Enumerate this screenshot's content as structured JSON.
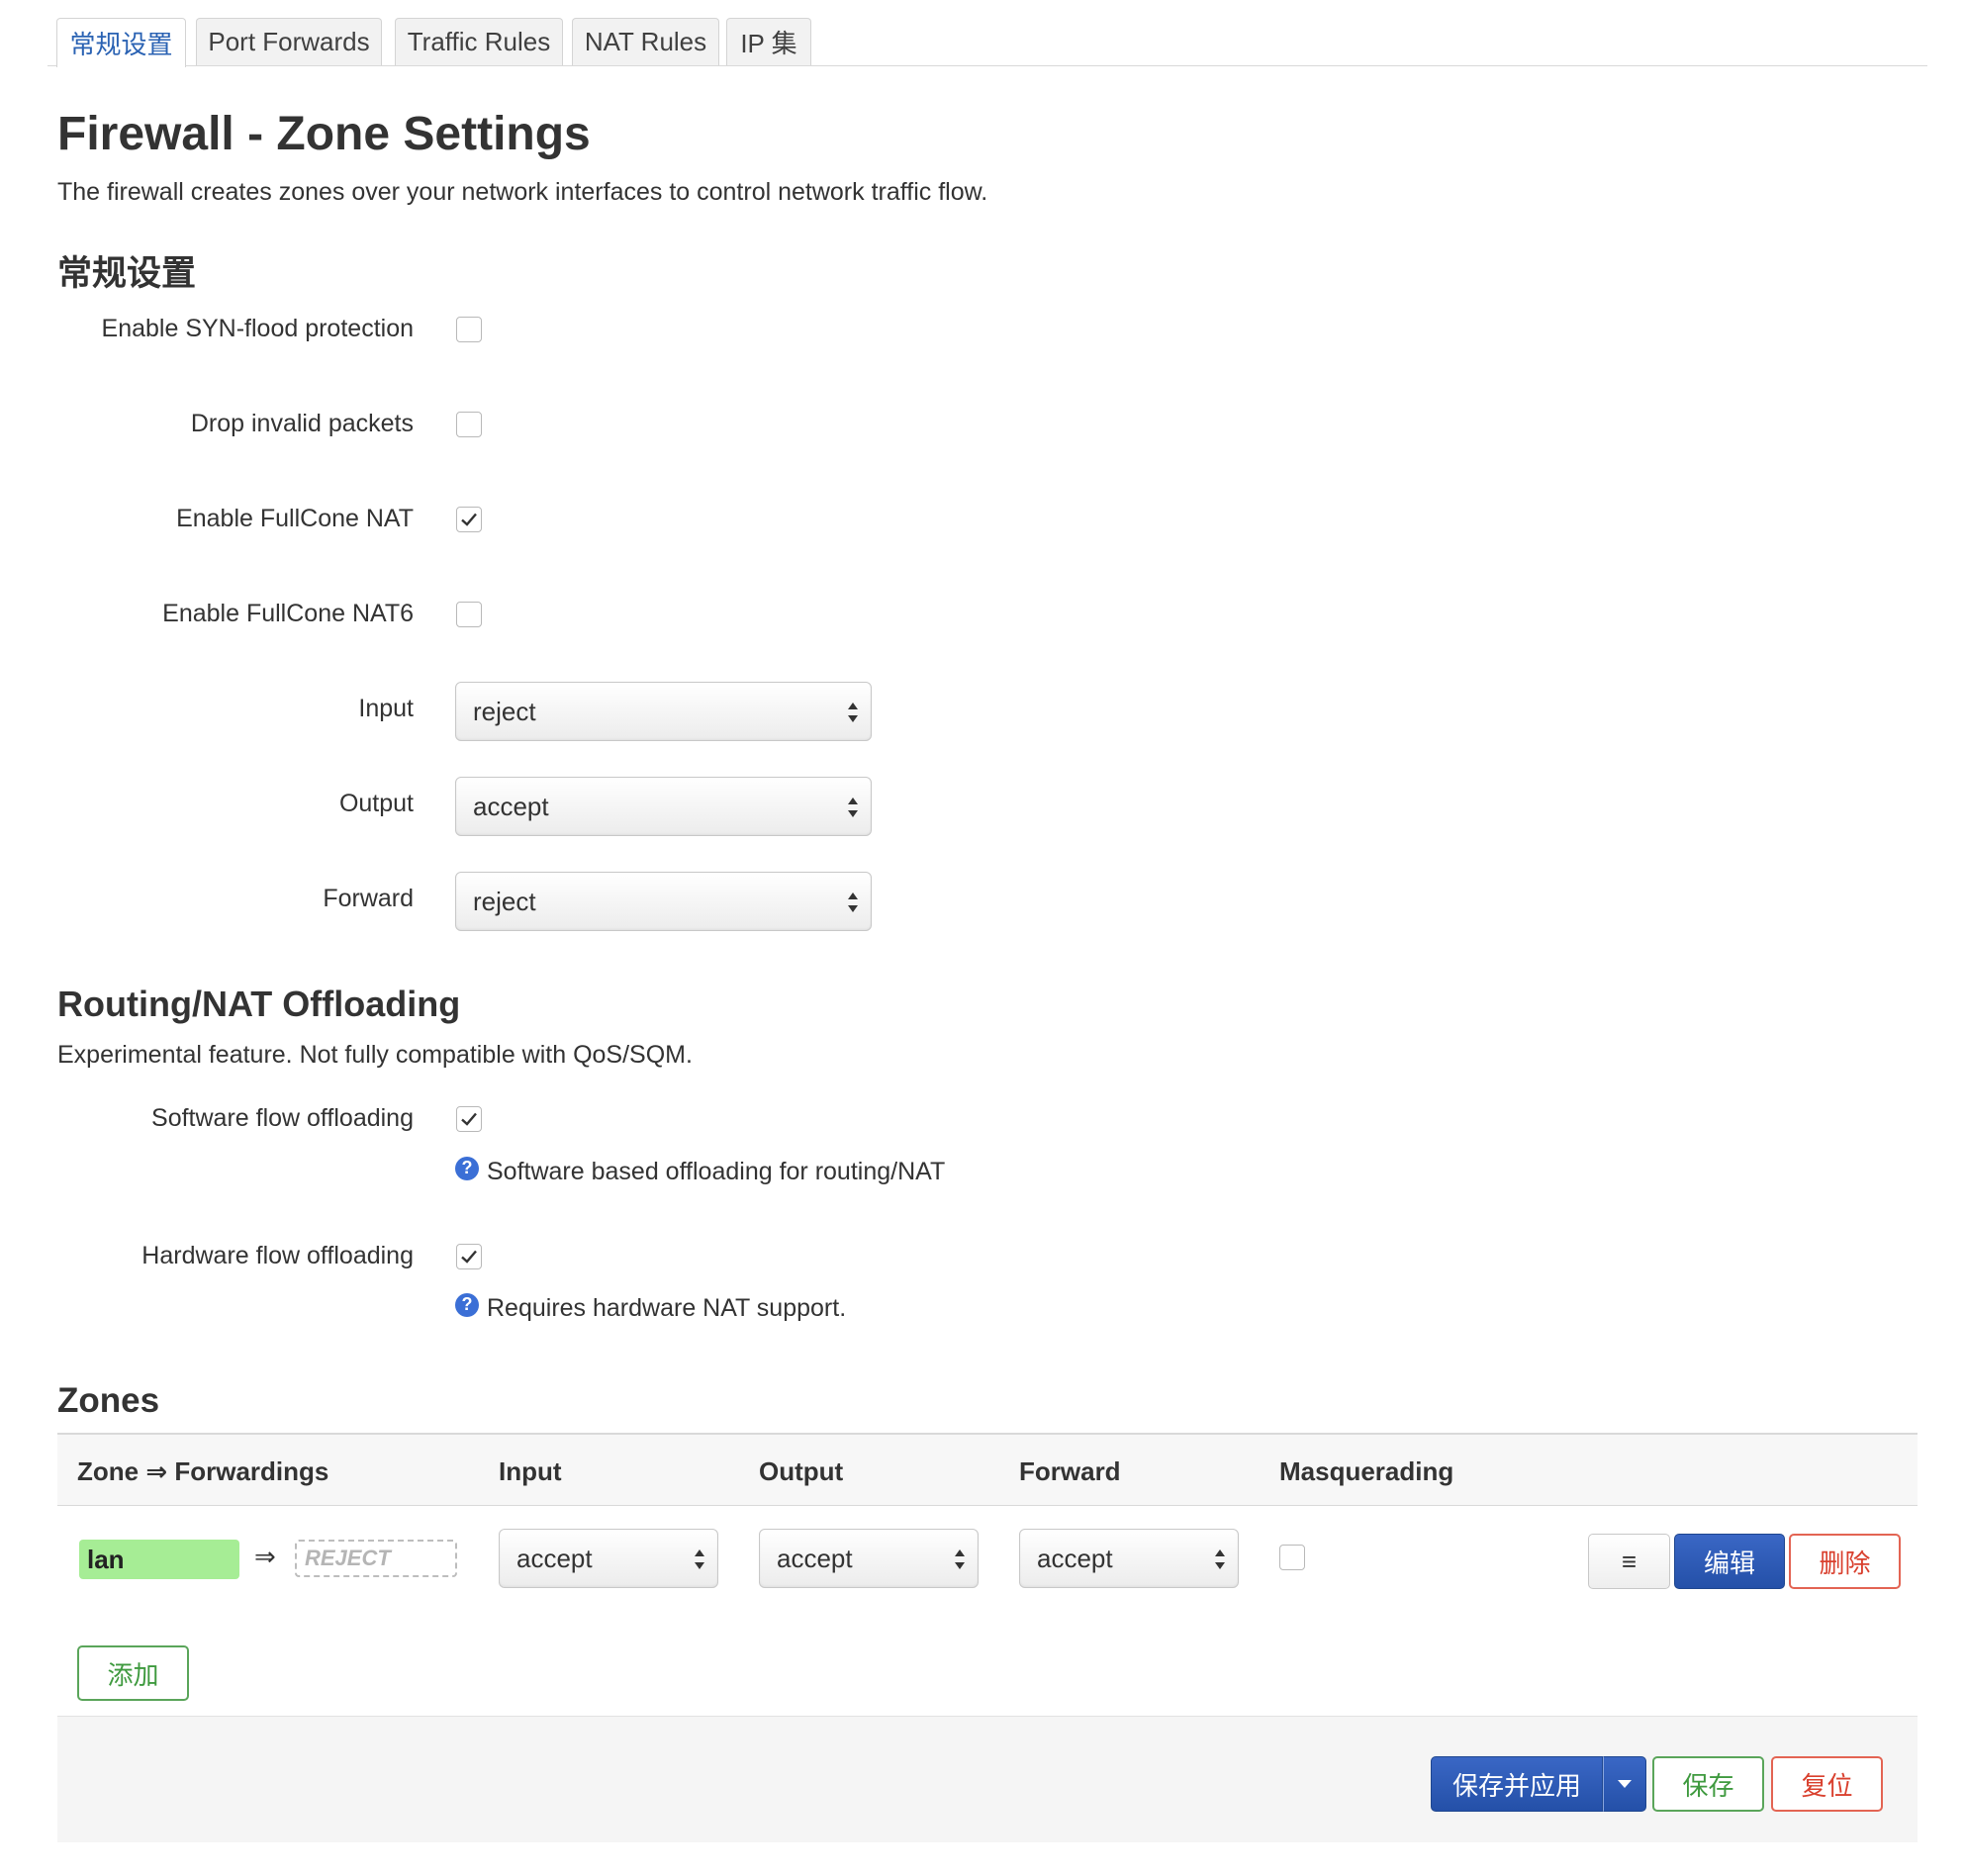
{
  "tabs": [
    {
      "label": "常规设置",
      "active": true
    },
    {
      "label": "Port Forwards",
      "active": false
    },
    {
      "label": "Traffic Rules",
      "active": false
    },
    {
      "label": "NAT Rules",
      "active": false
    },
    {
      "label": "IP 集",
      "active": false
    }
  ],
  "page": {
    "title": "Firewall - Zone Settings",
    "description": "The firewall creates zones over your network interfaces to control network traffic flow."
  },
  "general": {
    "heading": "常规设置",
    "syn_flood": {
      "label": "Enable SYN-flood protection",
      "checked": false
    },
    "drop_invalid": {
      "label": "Drop invalid packets",
      "checked": false
    },
    "fullcone_nat": {
      "label": "Enable FullCone NAT",
      "checked": true
    },
    "fullcone_nat6": {
      "label": "Enable FullCone NAT6",
      "checked": false
    },
    "input": {
      "label": "Input",
      "value": "reject"
    },
    "output": {
      "label": "Output",
      "value": "accept"
    },
    "forward": {
      "label": "Forward",
      "value": "reject"
    }
  },
  "offloading": {
    "heading": "Routing/NAT Offloading",
    "description": "Experimental feature. Not fully compatible with QoS/SQM.",
    "software": {
      "label": "Software flow offloading",
      "checked": true,
      "help": "Software based offloading for routing/NAT"
    },
    "hardware": {
      "label": "Hardware flow offloading",
      "checked": true,
      "help": "Requires hardware NAT support."
    }
  },
  "zones": {
    "heading": "Zones",
    "columns": {
      "zone": "Zone ⇒ Forwardings",
      "input": "Input",
      "output": "Output",
      "forward": "Forward",
      "masquerading": "Masquerading"
    },
    "rows": [
      {
        "name": "lan",
        "name_color": "#a6ed95",
        "arrow": "⇒",
        "forwarding": "REJECT",
        "input": "accept",
        "output": "accept",
        "forward": "accept",
        "masquerading": false,
        "sort_label": "≡",
        "edit_label": "编辑",
        "delete_label": "删除"
      }
    ],
    "add_label": "添加"
  },
  "footer": {
    "save_apply": "保存并应用",
    "save": "保存",
    "reset": "复位"
  },
  "colors": {
    "accent": "#2a62b3",
    "primary_button": "#2450a8",
    "danger": "#d9402e",
    "success": "#3f9a3f"
  }
}
